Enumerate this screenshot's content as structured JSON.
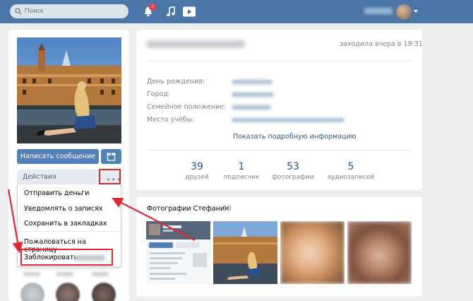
{
  "header": {
    "search_placeholder": "Поиск",
    "notifications_count": "3",
    "icons": [
      "search-icon",
      "bell-icon",
      "music-icon",
      "video-icon"
    ]
  },
  "profile": {
    "write_message": "Написать сообщение",
    "actions_label": "Действия",
    "actions_more": "•••",
    "last_seen": "заходила вчера в 19:31",
    "info": [
      {
        "label": "День рождения:"
      },
      {
        "label": "Город:"
      },
      {
        "label": "Семейное положение:"
      },
      {
        "label": "Место учёбы:"
      }
    ],
    "show_more": "Показать подробную информацию",
    "stats": [
      {
        "num": "39",
        "label": "друзей"
      },
      {
        "num": "1",
        "label": "подписчик"
      },
      {
        "num": "53",
        "label": "фотографии"
      },
      {
        "num": "5",
        "label": "аудиозаписей"
      }
    ]
  },
  "actions_menu": {
    "items": [
      "Отправить деньги",
      "Уведомлять о записях",
      "Сохранить в закладках",
      "Пожаловаться на страницу",
      "Заблокировать"
    ]
  },
  "photos": {
    "title": "Фотографии Стефании",
    "count": "53"
  },
  "colors": {
    "header": "#4a76a8",
    "button": "#5181b8",
    "link": "#2a5885",
    "highlight": "#e6262f"
  }
}
